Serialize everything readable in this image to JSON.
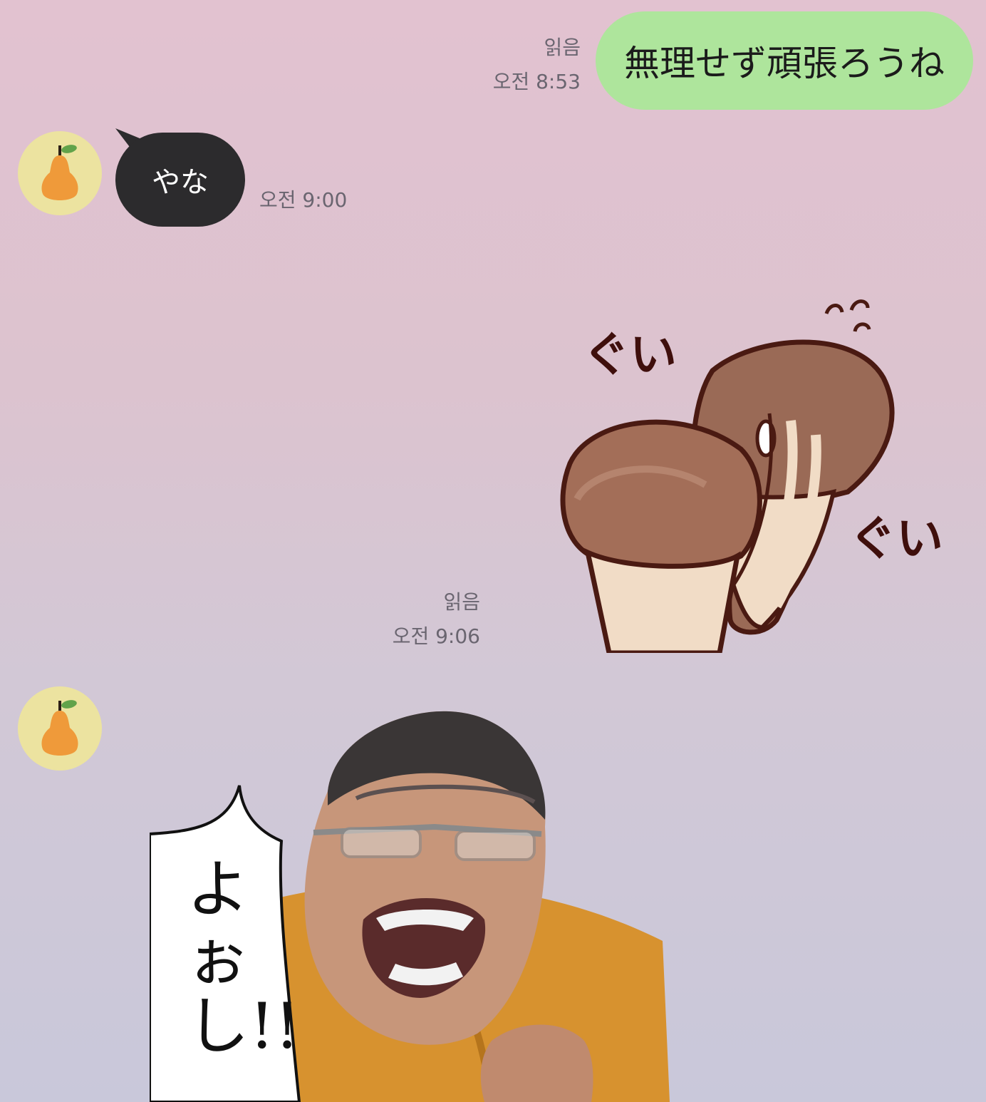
{
  "messages": {
    "m1": {
      "read": "읽음",
      "time": "오전 8:53",
      "text": "無理せず頑張ろうね"
    },
    "m2": {
      "text": "やな",
      "time": "오전 9:00"
    },
    "m3": {
      "read": "읽음",
      "time": "오전 9:06",
      "sticker_text_1": "ぐい",
      "sticker_text_2": "ぐい"
    },
    "m4": {
      "sticker_text": "よぉし!!"
    }
  },
  "colors": {
    "outgoing_bubble": "#aee59c",
    "incoming_bubble": "#2c2b2d",
    "avatar_bg": "#ece3a0",
    "avatar_pear": "#ef9a3a"
  },
  "icons": {
    "avatar": "pear-icon"
  }
}
